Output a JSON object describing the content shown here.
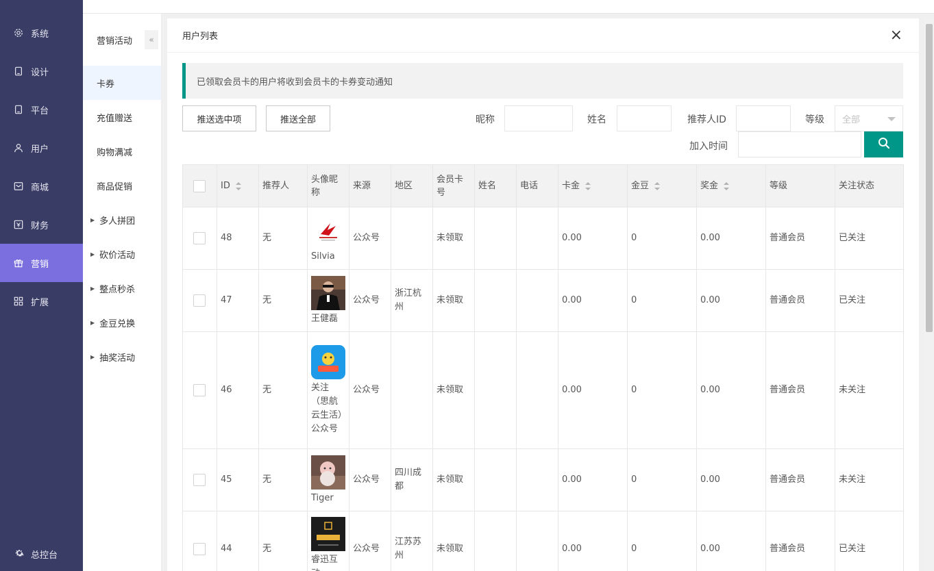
{
  "colors": {
    "sidebar": "#393d65",
    "sidebar_active": "#7b6fe0",
    "accent": "#009688",
    "followed": "#009900",
    "unfollowed": "#dd0000"
  },
  "sidebar": {
    "items": [
      {
        "label": "系统",
        "icon": "gear-icon"
      },
      {
        "label": "设计",
        "icon": "tablet-icon"
      },
      {
        "label": "平台",
        "icon": "tablet-icon"
      },
      {
        "label": "用户",
        "icon": "user-icon"
      },
      {
        "label": "商城",
        "icon": "mail-icon"
      },
      {
        "label": "财务",
        "icon": "finance-icon"
      },
      {
        "label": "营销",
        "icon": "gift-icon",
        "active": true
      },
      {
        "label": "扩展",
        "icon": "grid-icon"
      }
    ],
    "bottom_label": "总控台"
  },
  "submenu": {
    "title": "营销活动",
    "collapse_icon": "«",
    "items": [
      {
        "label": "卡券",
        "active": true,
        "group": false
      },
      {
        "label": "充值赠送",
        "group": false
      },
      {
        "label": "购物满减",
        "group": false
      },
      {
        "label": "商品促销",
        "group": false
      },
      {
        "label": "多人拼团",
        "group": true
      },
      {
        "label": "砍价活动",
        "group": true
      },
      {
        "label": "整点秒杀",
        "group": true
      },
      {
        "label": "金豆兑换",
        "group": true
      },
      {
        "label": "抽奖活动",
        "group": true
      }
    ]
  },
  "panel": {
    "title": "用户列表",
    "close": "×",
    "notice": "已领取会员卡的用户将收到会员卡的卡券变动通知",
    "buttons": {
      "push_selected": "推送选中项",
      "push_all": "推送全部"
    },
    "filters": {
      "nickname": "昵称",
      "name": "姓名",
      "referrer_id": "推荐人ID",
      "level": "等级",
      "level_value": "全部",
      "join_time": "加入时间"
    }
  },
  "table": {
    "headers": [
      "ID",
      "推荐人",
      "头像昵称",
      "来源",
      "地区",
      "会员卡号",
      "姓名",
      "电话",
      "卡金",
      "金豆",
      "奖金",
      "等级",
      "关注状态"
    ],
    "rows": [
      {
        "id": "48",
        "referrer": "无",
        "nickname": "Silvia",
        "source": "公众号",
        "region": "",
        "card": "未领取",
        "name": "",
        "phone": "",
        "card_money": "0.00",
        "beans": "0",
        "bonus": "0.00",
        "level": "普通会员",
        "status": "已关注",
        "followed": true,
        "avatar": "logo"
      },
      {
        "id": "47",
        "referrer": "无",
        "nickname": "王健磊",
        "source": "公众号",
        "region": "浙江杭州",
        "card": "未领取",
        "name": "",
        "phone": "",
        "card_money": "0.00",
        "beans": "0",
        "bonus": "0.00",
        "level": "普通会员",
        "status": "已关注",
        "followed": true,
        "avatar": "man"
      },
      {
        "id": "46",
        "referrer": "无",
        "nickname": "关注（思航云生活）公众号",
        "source": "公众号",
        "region": "",
        "card": "未领取",
        "name": "",
        "phone": "",
        "card_money": "0.00",
        "beans": "0",
        "bonus": "0.00",
        "level": "普通会员",
        "status": "未关注",
        "followed": false,
        "avatar": "app"
      },
      {
        "id": "45",
        "referrer": "无",
        "nickname": "Tiger",
        "source": "公众号",
        "region": "四川成都",
        "card": "未领取",
        "name": "",
        "phone": "",
        "card_money": "0.00",
        "beans": "0",
        "bonus": "0.00",
        "level": "普通会员",
        "status": "未关注",
        "followed": false,
        "avatar": "baby"
      },
      {
        "id": "44",
        "referrer": "无",
        "nickname": "睿迅互动",
        "source": "公众号",
        "region": "江苏苏州",
        "card": "未领取",
        "name": "",
        "phone": "",
        "card_money": "0.00",
        "beans": "0",
        "bonus": "0.00",
        "level": "普通会员",
        "status": "已关注",
        "followed": true,
        "avatar": "brand"
      }
    ]
  }
}
